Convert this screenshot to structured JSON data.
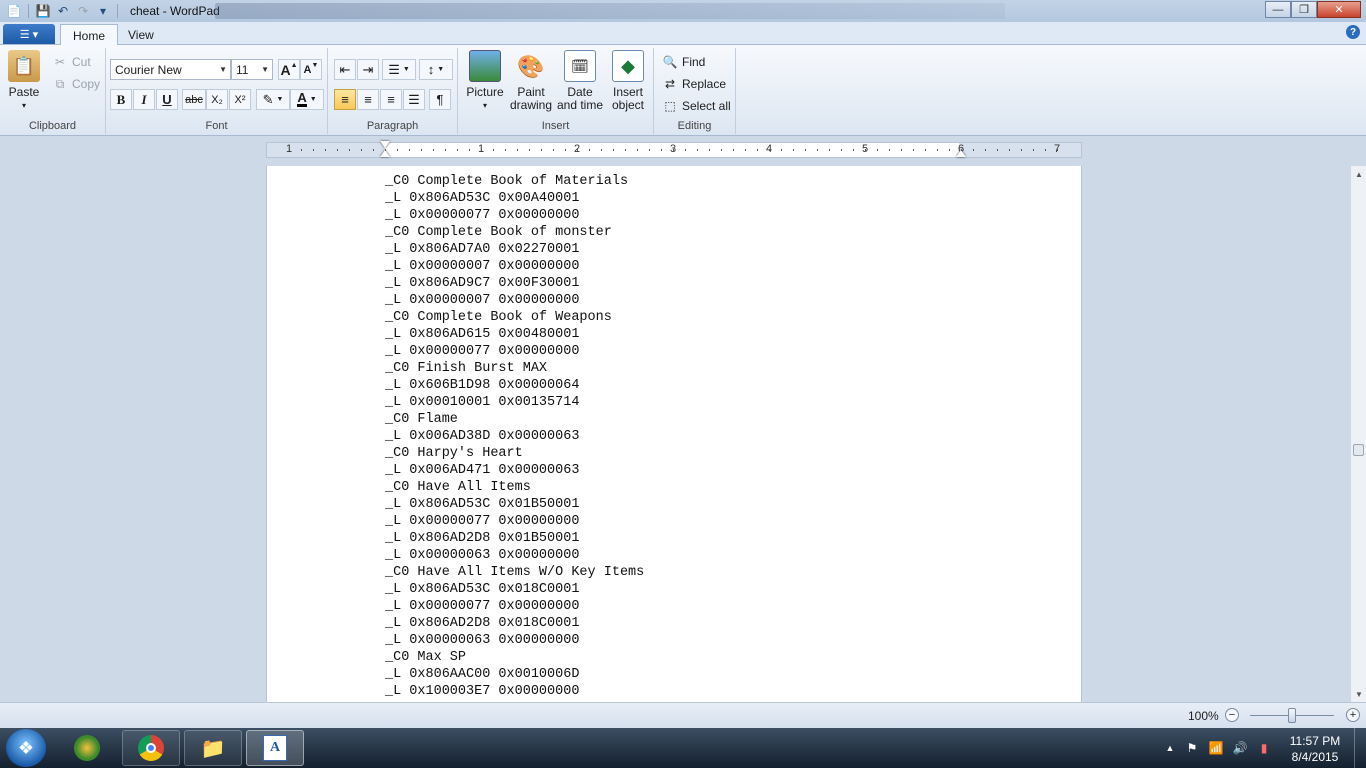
{
  "window": {
    "title": "cheat - WordPad",
    "qat_customize": "▾"
  },
  "tabs": {
    "file_menu_glyph": "☰ ▾",
    "home": "Home",
    "view": "View",
    "help": "?"
  },
  "clipboard": {
    "paste": "Paste",
    "cut": "Cut",
    "copy": "Copy",
    "label": "Clipboard"
  },
  "font": {
    "family": "Courier New",
    "size": "11",
    "grow": "A",
    "shrink": "A",
    "bold": "B",
    "italic": "I",
    "underline": "U",
    "strikethrough": "abc",
    "subscript": "X₂",
    "superscript": "X²",
    "text_color": "A",
    "label": "Font"
  },
  "paragraph": {
    "label": "Paragraph"
  },
  "insert": {
    "picture": "Picture",
    "paint_drawing": "Paint drawing",
    "date_time": "Date and time",
    "insert_object": "Insert object",
    "label": "Insert"
  },
  "editing": {
    "find": "Find",
    "replace": "Replace",
    "select_all": "Select all",
    "label": "Editing"
  },
  "ruler": {
    "numbers": [
      "1",
      "1",
      "2",
      "3",
      "4",
      "5",
      "6",
      "7"
    ]
  },
  "document": {
    "lines": [
      "_C0 Complete Book of Materials",
      "_L 0x806AD53C 0x00A40001",
      "_L 0x00000077 0x00000000",
      "_C0 Complete Book of monster",
      "_L 0x806AD7A0 0x02270001",
      "_L 0x00000007 0x00000000",
      "_L 0x806AD9C7 0x00F30001",
      "_L 0x00000007 0x00000000",
      "_C0 Complete Book of Weapons",
      "_L 0x806AD615 0x00480001",
      "_L 0x00000077 0x00000000",
      "_C0 Finish Burst MAX",
      "_L 0x606B1D98 0x00000064",
      "_L 0x00010001 0x00135714",
      "_C0 Flame",
      "_L 0x006AD38D 0x00000063",
      "_C0 Harpy's Heart",
      "_L 0x006AD471 0x00000063",
      "_C0 Have All Items",
      "_L 0x806AD53C 0x01B50001",
      "_L 0x00000077 0x00000000",
      "_L 0x806AD2D8 0x01B50001",
      "_L 0x00000063 0x00000000",
      "_C0 Have All Items W/O Key Items",
      "_L 0x806AD53C 0x018C0001",
      "_L 0x00000077 0x00000000",
      "_L 0x806AD2D8 0x018C0001",
      "_L 0x00000063 0x00000000",
      "_C0 Max SP",
      "_L 0x806AAC00 0x0010006D",
      "_L 0x100003E7 0x00000000"
    ]
  },
  "status": {
    "zoom": "100%",
    "zoom_out": "−",
    "zoom_in": "+",
    "zoom_level": 1.0
  },
  "taskbar": {
    "time": "11:57 PM",
    "date": "8/4/2015",
    "apps": [
      "windows-media-player",
      "chrome",
      "file-explorer",
      "wordpad"
    ]
  },
  "colors": {
    "ribbon_active": "#f8c85a",
    "accent": "#1d5aa8"
  }
}
